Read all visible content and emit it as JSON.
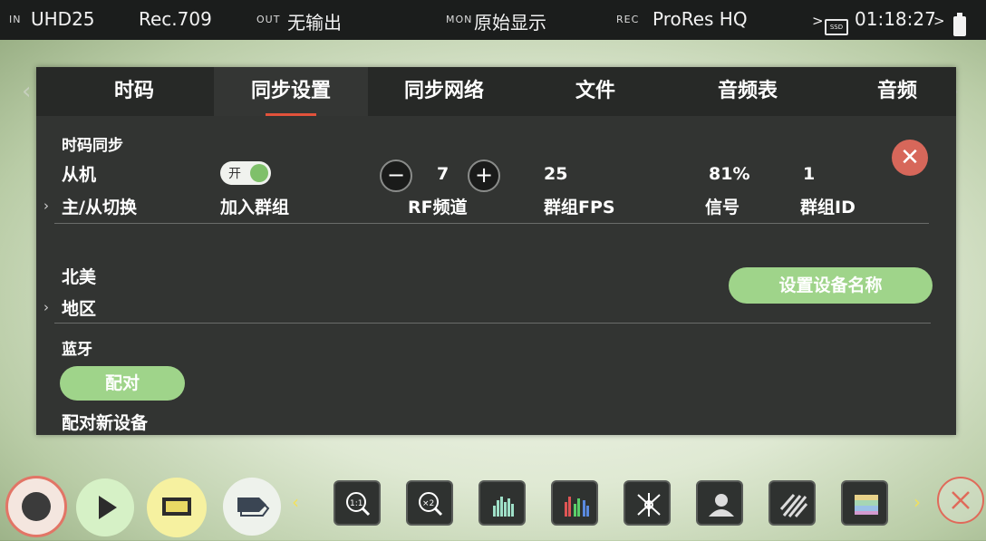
{
  "status_bar": {
    "in_label": "IN",
    "in_value": "UHD25",
    "color_space": "Rec.709",
    "out_label": "OUT",
    "out_value": "无输出",
    "mon_label": "MON",
    "mon_value": "原始显示",
    "rec_label": "REC",
    "rec_value": "ProRes HQ",
    "ssd_label": "SSD",
    "timecode": "01:18:27"
  },
  "tabs": [
    {
      "label": "时码"
    },
    {
      "label": "同步设置",
      "active": true
    },
    {
      "label": "同步网络"
    },
    {
      "label": "文件"
    },
    {
      "label": "音频表"
    },
    {
      "label": "音频"
    }
  ],
  "sync": {
    "section_title": "时码同步",
    "role_value": "从机",
    "role_label": "主/从切换",
    "join_toggle_text": "开",
    "join_label": "加入群组",
    "rf_channel_value": "7",
    "rf_channel_label": "RF频道",
    "group_fps_value": "25",
    "group_fps_label": "群组FPS",
    "signal_value": "81%",
    "signal_label": "信号",
    "group_id_value": "1",
    "group_id_label": "群组ID"
  },
  "region": {
    "value": "北美",
    "label": "地区",
    "set_device_name_button": "设置设备名称"
  },
  "bluetooth": {
    "title": "蓝牙",
    "pair_button": "配对",
    "pair_label": "配对新设备"
  },
  "colors": {
    "accent": "#e2523b",
    "green": "#9fd48a",
    "panel": "#323432",
    "record": "#d95a4b"
  },
  "icons": [
    "record-icon",
    "play-icon",
    "display-mode-icon",
    "tag-icon",
    "zoom-1to1-icon",
    "zoom-x2-icon",
    "waveform-icon",
    "rgb-parade-icon",
    "vectorscope-icon",
    "focus-peaking-icon",
    "zebra-icon",
    "false-color-icon",
    "close-icon"
  ]
}
